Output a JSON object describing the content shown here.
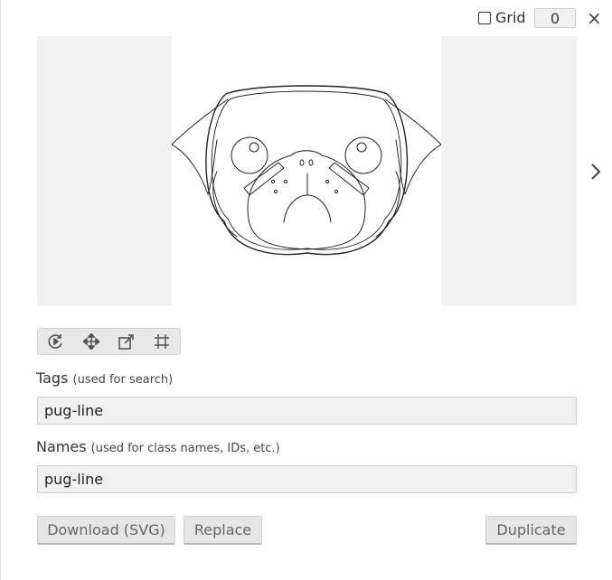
{
  "header": {
    "grid_label": "Grid",
    "grid_size": "0",
    "close_glyph": "×"
  },
  "preview": {
    "image_name": "pug-line",
    "next_icon": "chevron-right-icon"
  },
  "toolbar": {
    "tools": [
      "rotate-icon",
      "move-icon",
      "scale-icon",
      "crop-grid-icon"
    ]
  },
  "tags": {
    "label": "Tags",
    "hint": "(used for search)",
    "value": "pug-line"
  },
  "names": {
    "label": "Names",
    "hint": "(used for class names, IDs, etc.)",
    "value": "pug-line"
  },
  "buttons": {
    "download": "Download (SVG)",
    "replace": "Replace",
    "duplicate": "Duplicate"
  }
}
